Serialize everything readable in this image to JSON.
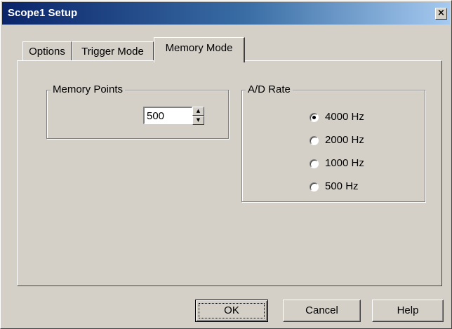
{
  "window": {
    "title": "Scope1 Setup",
    "close_glyph": "×"
  },
  "tabs": [
    {
      "label": "Options",
      "active": false
    },
    {
      "label": "Trigger Mode",
      "active": false
    },
    {
      "label": "Memory Mode",
      "active": true
    }
  ],
  "memory_points": {
    "label": "Memory Points",
    "value": "500",
    "up_glyph": "▲",
    "down_glyph": "▼"
  },
  "ad_rate": {
    "label": "A/D Rate",
    "selected": "4000 Hz",
    "options": [
      "4000 Hz",
      "2000 Hz",
      "1000 Hz",
      "500 Hz"
    ]
  },
  "buttons": {
    "ok": "OK",
    "cancel": "Cancel",
    "help": "Help"
  },
  "colors": {
    "dialog_face": "#d4d0c8",
    "titlebar_start": "#0a246a",
    "titlebar_end": "#a6caf0"
  }
}
